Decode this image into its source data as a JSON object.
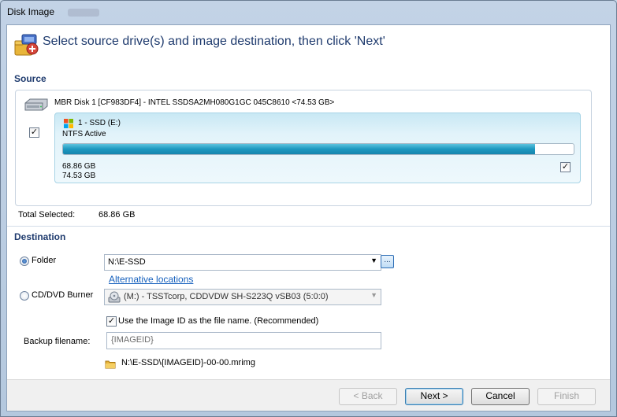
{
  "window": {
    "title": "Disk Image"
  },
  "header": {
    "title": "Select source drive(s) and image destination, then click 'Next'"
  },
  "source": {
    "section_title": "Source",
    "disk_label": "MBR Disk 1 [CF983DF4] - INTEL SSDSA2MH080G1GC 045C8610  <74.53 GB>",
    "disk_checked": true,
    "partition": {
      "label": "1 - SSD (E:)",
      "filesystem": "NTFS Active",
      "used_fraction": 0.924,
      "used": "68.86 GB",
      "total": "74.53 GB",
      "checked": true
    },
    "total_selected_label": "Total Selected:",
    "total_selected_value": "68.86 GB"
  },
  "destination": {
    "section_title": "Destination",
    "folder": {
      "label": "Folder",
      "selected": true,
      "value": "N:\\E-SSD",
      "browse_label": "..."
    },
    "alt_locations_link": "Alternative locations",
    "burner": {
      "label": "CD/DVD Burner",
      "selected": false,
      "value": "(M:) - TSSTcorp, CDDVDW SH-S223Q  vSB03 (5:0:0)"
    },
    "use_image_id": {
      "label": "Use the Image ID as the file name.  (Recommended)",
      "checked": true
    },
    "backup_filename": {
      "label": "Backup filename:",
      "value": "{IMAGEID}"
    },
    "output_path": "N:\\E-SSD\\{IMAGEID}-00-00.mrimg"
  },
  "footer": {
    "back_label": "< Back",
    "next_label": "Next >",
    "cancel_label": "Cancel",
    "finish_label": "Finish"
  },
  "colors": {
    "accent": "#1f3b6e",
    "bar_fill": "#1d98c0",
    "partition_bg": "#d9f0f8",
    "link": "#1560bd"
  },
  "icons": {
    "header": "disk-image-wizard-icon",
    "disk": "hard-drive-icon",
    "partition": "windows-partition-icon",
    "burner": "optical-drive-icon",
    "folder": "folder-icon"
  }
}
